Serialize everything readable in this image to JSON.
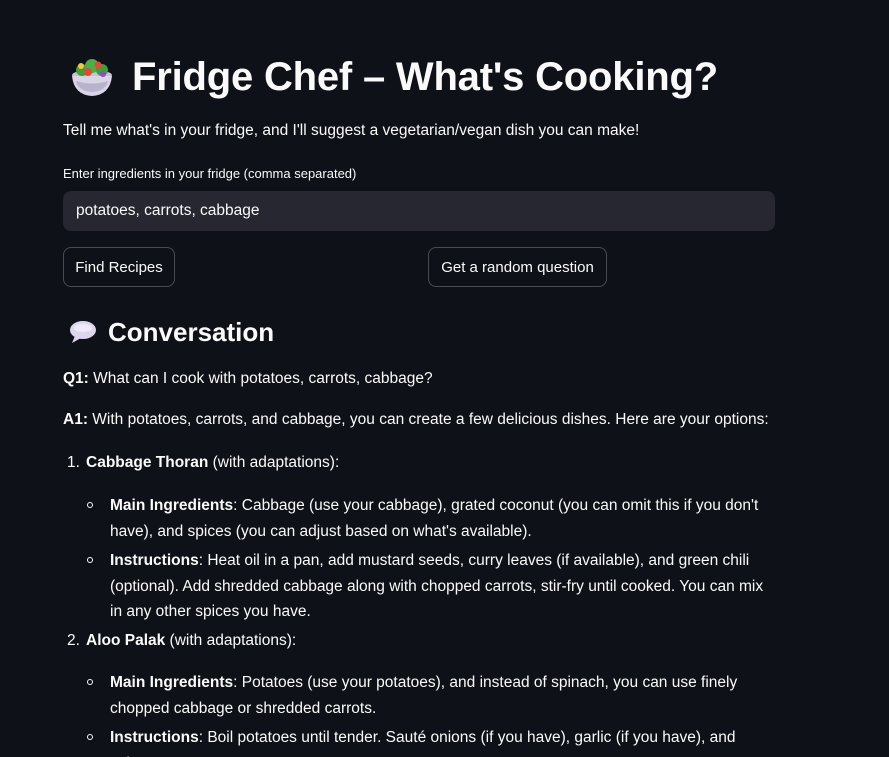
{
  "header": {
    "title": "Fridge Chef – What's Cooking?",
    "subtitle": "Tell me what's in your fridge, and I'll suggest a vegetarian/vegan dish you can make!"
  },
  "ingredients": {
    "label": "Enter ingredients in your fridge (comma separated)",
    "value": "potatoes, carrots, cabbage"
  },
  "buttons": {
    "find_recipes": "Find Recipes",
    "random_question": "Get a random question"
  },
  "conversation": {
    "title": "Conversation",
    "q1_label": "Q1:",
    "q1_text": " What can I cook with potatoes, carrots, cabbage?",
    "a1_label": "A1:",
    "a1_text": " With potatoes, carrots, and cabbage, you can create a few delicious dishes. Here are your options:",
    "recipes": [
      {
        "number": "1.",
        "name": "Cabbage Thoran",
        "suffix": " (with adaptations):",
        "bullets": [
          {
            "label": "Main Ingredients",
            "text": ": Cabbage (use your cabbage), grated coconut (you can omit this if you don't have), and spices (you can adjust based on what's available)."
          },
          {
            "label": "Instructions",
            "text": ": Heat oil in a pan, add mustard seeds, curry leaves (if available), and green chili (optional). Add shredded cabbage along with chopped carrots, stir-fry until cooked. You can mix in any other spices you have."
          }
        ]
      },
      {
        "number": "2.",
        "name": "Aloo Palak",
        "suffix": " (with adaptations):",
        "bullets": [
          {
            "label": "Main Ingredients",
            "text": ": Potatoes (use your potatoes), and instead of spinach, you can use finely chopped cabbage or shredded carrots."
          },
          {
            "label": "Instructions",
            "text": ": Boil potatoes until tender. Sauté onions (if you have), garlic (if you have), and spices,"
          }
        ]
      }
    ]
  },
  "icons": {
    "title_icon": "salad-bowl-icon",
    "section_icon": "speech-bubble-icon"
  },
  "colors": {
    "background": "#0e1117",
    "input_background": "#262730",
    "text": "#fafafa"
  }
}
